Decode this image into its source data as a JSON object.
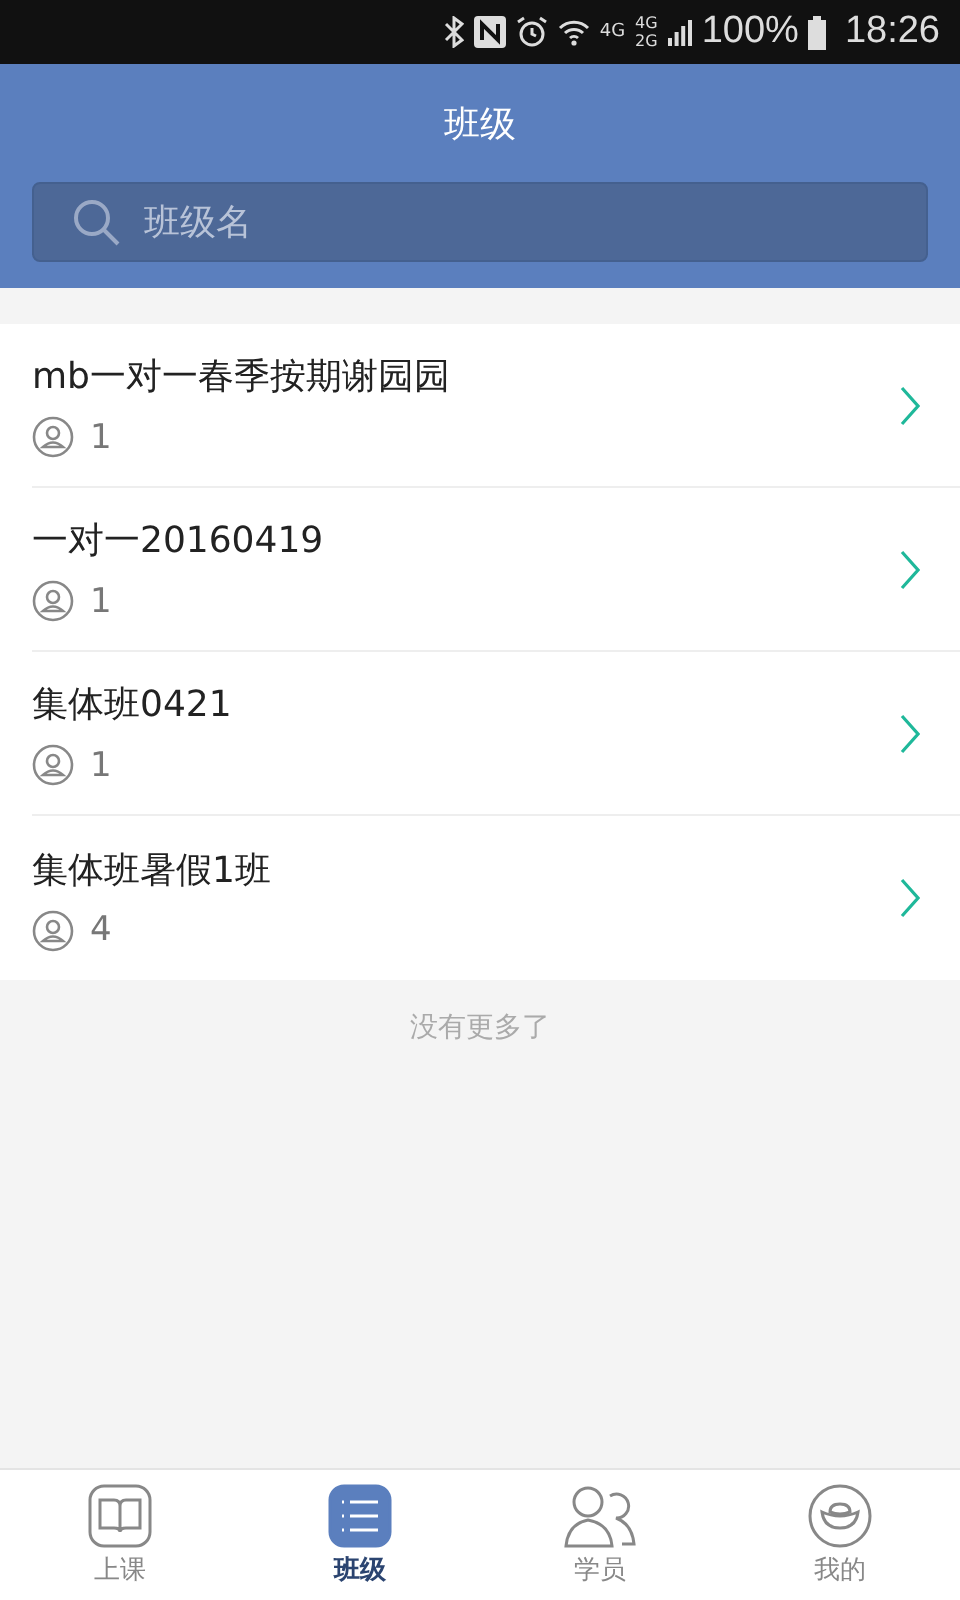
{
  "status_bar": {
    "network_1": "4G",
    "network_2_top": "4G",
    "network_2_bottom": "2G",
    "battery": "100%",
    "time": "18:26"
  },
  "header": {
    "title": "班级"
  },
  "search": {
    "placeholder": "班级名"
  },
  "classes": [
    {
      "name": "mb一对一春季按期谢园园",
      "students": "1"
    },
    {
      "name": "一对一20160419",
      "students": "1"
    },
    {
      "name": "集体班0421",
      "students": "1"
    },
    {
      "name": "集体班暑假1班",
      "students": "4"
    }
  ],
  "footer_note": "没有更多了",
  "tabs": [
    {
      "kind": "book",
      "label": "上课",
      "selected": false
    },
    {
      "kind": "list",
      "label": "班级",
      "selected": true
    },
    {
      "kind": "people",
      "label": "学员",
      "selected": false
    },
    {
      "kind": "ingot",
      "label": "我的",
      "selected": false
    }
  ]
}
